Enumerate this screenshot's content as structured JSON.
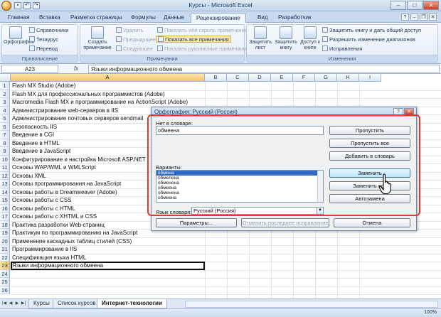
{
  "window": {
    "title": "Курсы - Microsoft Excel"
  },
  "ribbon_tabs": [
    "Главная",
    "Вставка",
    "Разметка страницы",
    "Формулы",
    "Данные",
    "Рецензирование",
    "Вид",
    "Разработчик"
  ],
  "ribbon": {
    "proofing": {
      "label": "Правописание",
      "spelling": "Орфография",
      "research": "Справочники",
      "thesaurus": "Тезаурус",
      "translate": "Перевод"
    },
    "comments": {
      "label": "Примечания",
      "new": "Создать примечание",
      "delete": "Удалить",
      "previous": "Предыдущее",
      "next": "Следующее",
      "show_hide": "Показать или скрыть примечание",
      "show_all": "Показать все примечания",
      "show_ink": "Показать рукописные примечания"
    },
    "changes": {
      "label": "Изменения",
      "protect_sheet": "Защитить лист",
      "protect_book": "Защитить книгу",
      "share": "Доступ к книге",
      "protect_share": "Защитить книгу и дать общий доступ",
      "allow_edit": "Разрешить изменение диапазонов",
      "track": "Исправления"
    }
  },
  "formula_bar": {
    "name_box": "A23",
    "fx": "fx",
    "content": "Языки информационного обмеена"
  },
  "columns": [
    "A",
    "B",
    "C",
    "D",
    "E",
    "F",
    "G",
    "H",
    "I"
  ],
  "rows": [
    "Flash MX Studio (Adobe)",
    "Flash MX для профессиональных программистов (Adobe)",
    "Macromedia Flash MX и программирование на ActionScript (Adobe)",
    "Администрирование web-серверов в IIS",
    "Администрирование почтовых серверов sendmail",
    "Безопасность IIS",
    "Введение в CGI",
    "Введение в HTML",
    "Введение в JavaScript",
    "Конфигурирование и настройка Microsoft ASP.NET",
    "Основы WAP/WML и WMLScript",
    "Основы XML",
    "Основы программирования на JavaScript",
    "Основы работы в Dreamweaver (Adobe)",
    "Основы работы с CSS",
    "Основы работы с HTML",
    "Основы работы с XHTML и CSS",
    "Практика разработки Web-страниц",
    "Практикум по программированию на JavaScript",
    "Применение каскадных таблиц стилей (CSS)",
    "Программирование в IIS",
    "Спецификация языка HTML",
    "Языки информационного обмеена",
    "",
    "",
    ""
  ],
  "sheet_tabs": [
    "Курсы",
    "Список курсов",
    "Интернет-технологии"
  ],
  "status": {
    "zoom": "100%"
  },
  "dialog": {
    "title": "Орфография: Русский (Россия)",
    "not_in_dict_label": "Нет в словаре:",
    "not_in_dict_value": "обмеена",
    "suggestions_label": "Варианты:",
    "suggestions": [
      "обмена",
      "обмелена",
      "обменена",
      "обмеена",
      "обменена",
      "обмеена"
    ],
    "dict_lang_label": "Язык словаря:",
    "dict_lang_value": "Русский (Россия)",
    "buttons": {
      "ignore_once": "Пропустить",
      "ignore_all": "Пропустить все",
      "add": "Добавить в словарь",
      "change": "Заменить",
      "change_all": "Заменить все",
      "autocorrect": "Автозамена",
      "options": "Параметры...",
      "undo": "Отменить последнее исправление",
      "cancel": "Отмена"
    }
  }
}
